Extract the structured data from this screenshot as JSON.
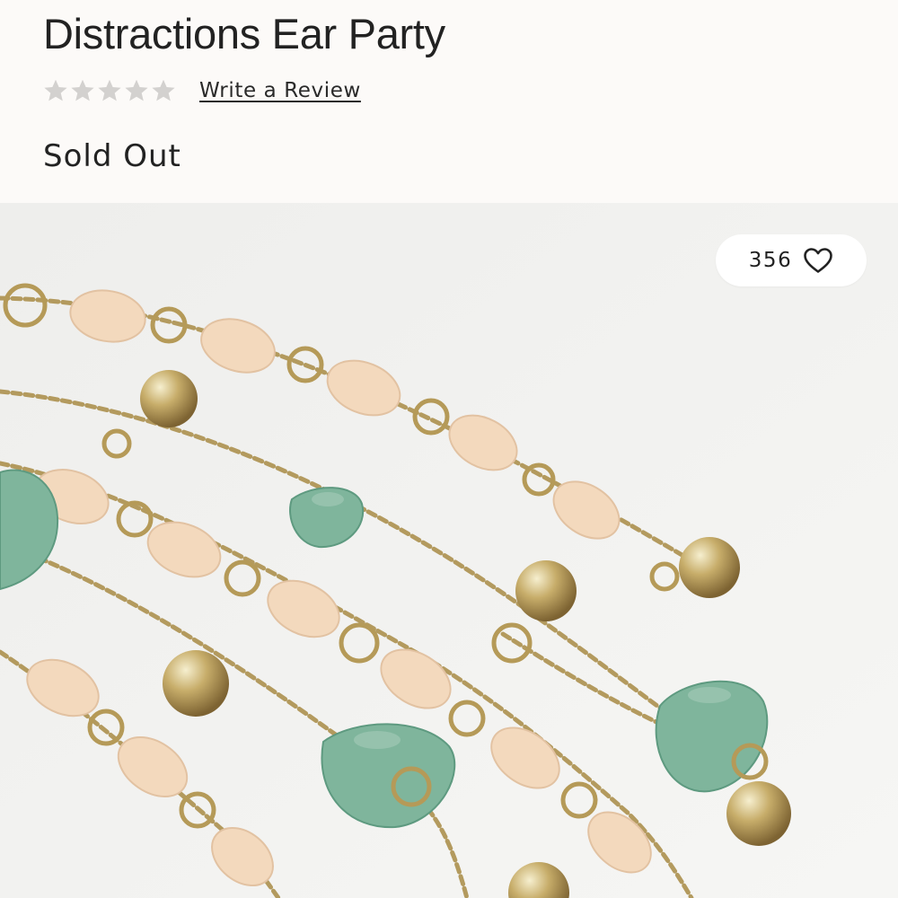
{
  "product": {
    "title": "Distractions Ear Party",
    "rating_value": 0,
    "rating_max": 5,
    "review_link_label": "Write a Review",
    "stock_status": "Sold Out"
  },
  "gallery": {
    "like_count": "356",
    "like_icon": "heart-outline-icon"
  },
  "colors": {
    "page_background": "#fcfaf8",
    "star_empty": "#d3d1cf",
    "text": "#222222",
    "image_background": "#f1f1ef"
  }
}
